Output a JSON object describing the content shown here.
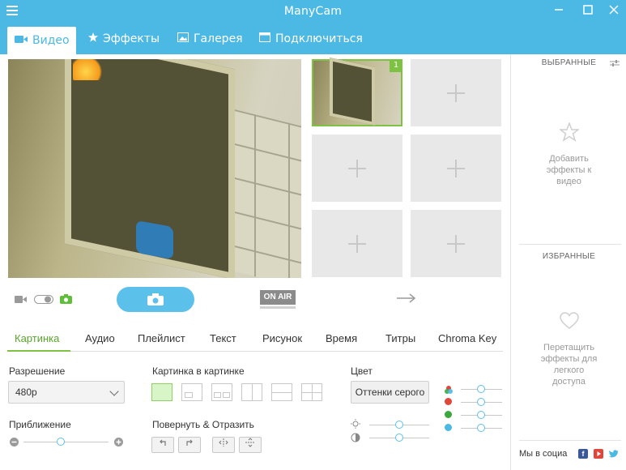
{
  "window": {
    "title": "ManyCam"
  },
  "tabs": [
    {
      "label": "Видео",
      "icon": "video-camera-icon",
      "active": true
    },
    {
      "label": "Эффекты",
      "icon": "star-icon",
      "active": false
    },
    {
      "label": "Галерея",
      "icon": "image-icon",
      "active": false
    },
    {
      "label": "Подключиться",
      "icon": "window-icon",
      "active": false
    }
  ],
  "scenes": {
    "active_badge": "1"
  },
  "controls": {
    "on_air_label": "ON AIR"
  },
  "subtabs": [
    "Картинка",
    "Аудио",
    "Плейлист",
    "Текст",
    "Рисунок",
    "Время",
    "Титры",
    "Chroma Key"
  ],
  "picture": {
    "resolution_label": "Разрешение",
    "resolution_value": "480p",
    "zoom_label": "Приближение",
    "pip_label": "Картинка в картинке",
    "rotate_label": "Повернуть & Отразить",
    "color_label": "Цвет",
    "color_button": "Оттенки серого",
    "zoom_level": 0.44
  },
  "colors": {
    "accent": "#4cb9e4",
    "green": "#7dc241",
    "red": "#e0463a",
    "green_dot": "#3aa83a",
    "blue_dot": "#4cb9e4"
  },
  "right_panel": {
    "favorites_head": "ВЫБРАННЫЕ",
    "favorites_hint_1": "Добавить",
    "favorites_hint_2": "эффекты к",
    "favorites_hint_3": "видео",
    "starred_head": "ИЗБРАННЫЕ",
    "starred_hint_1": "Перетащить",
    "starred_hint_2": "эффекты для",
    "starred_hint_3": "легкого",
    "starred_hint_4": "доступа",
    "social_text": "Мы в социа"
  }
}
